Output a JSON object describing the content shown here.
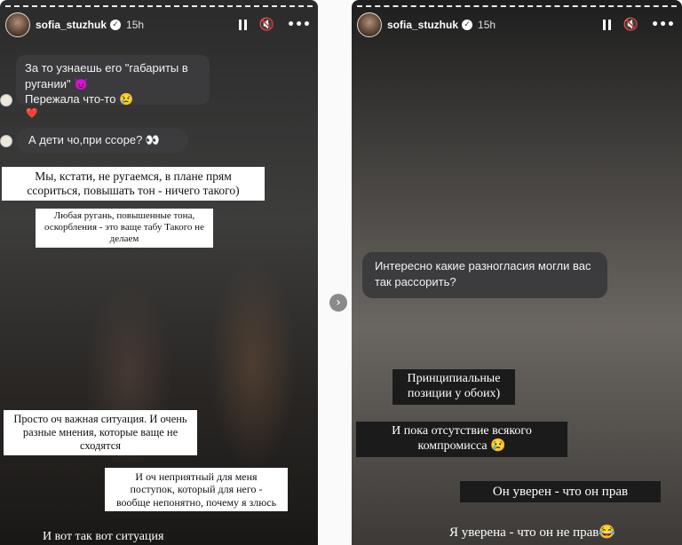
{
  "left_story": {
    "username": "sofia_stuzhuk",
    "time": "15h",
    "controls": {
      "pause": "pause-icon",
      "mute": "🔇",
      "more": "•••"
    },
    "chat": [
      "За то узнаешь его \"габариты в ругании\" 😈",
      "Пережала что-то 😢",
      "❤️",
      "А дети чо,при ссоре? 👀"
    ],
    "captions": [
      "Мы, кстати, не ругаемся, в плане прям ссориться, повышать тон - ничего такого)",
      "Любая ругань, повышенные тона, оскорбления - это ваще табу Такого не делаем",
      "Просто оч важная ситуация. И очень разные мнения, которые ваще не сходятся",
      "И оч неприятный для меня поступок, который для него - вообще непонятно, почему я злюсь",
      "И вот так вот ситуация"
    ]
  },
  "nav": {
    "next": "›"
  },
  "right_story": {
    "username": "sofia_stuzhuk",
    "time": "15h",
    "controls": {
      "pause": "pause-icon",
      "mute": "🔇",
      "more": "•••"
    },
    "question": "Интересно какие разногласия могли вас так рассорить?",
    "captions": [
      "Принципиальные позиции  у обоих)",
      "И пока отсутствие всякого компромисса 😢",
      "Он уверен - что он прав",
      "Я уверена - что он не прав😂"
    ]
  }
}
